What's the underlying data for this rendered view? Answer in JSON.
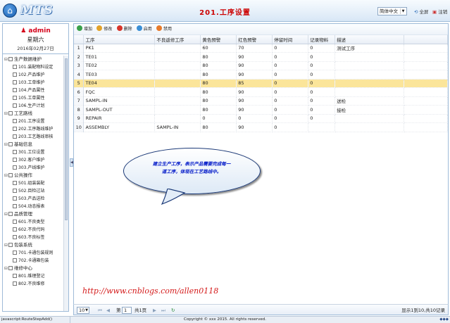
{
  "header": {
    "logo_glyph": "⌂",
    "logo_text": "MTS",
    "title": "201.工序设置",
    "language": "简体中文",
    "fullscreen": "全屏",
    "logout": "注销"
  },
  "user": {
    "name": "admin",
    "weekday": "星期六",
    "date": "2016年02月27日"
  },
  "tree": [
    {
      "label": "生产数据维护",
      "items": [
        "101.装配物料设定",
        "102.产品维护",
        "103.工单维护",
        "104.产品属性",
        "105.工单属性",
        "106.生产计划"
      ]
    },
    {
      "label": "工艺路线",
      "items": [
        "201.工序设置",
        "202.工序路线维护",
        "203.工艺路线审核"
      ]
    },
    {
      "label": "基础信息",
      "items": [
        "301.工位设置",
        "302.客户维护",
        "303.产线维护"
      ]
    },
    {
      "label": "公共操作",
      "items": [
        "501.组装装配",
        "502.目检过站",
        "503.产品送检",
        "504.动态报表"
      ]
    },
    {
      "label": "品质管理",
      "items": [
        "601.不良类型",
        "602.不良代码",
        "603.不良标签"
      ]
    },
    {
      "label": "包装系统",
      "items": [
        "701.卡通包装规则",
        "702.卡通箱包装"
      ]
    },
    {
      "label": "维修中心",
      "items": [
        "801.维理登记",
        "802.不良维修"
      ]
    }
  ],
  "toolbar": {
    "add": "增加",
    "edit": "修改",
    "delete": "删除",
    "enable": "启用",
    "disable": "禁用"
  },
  "table": {
    "columns": [
      "工序",
      "不良返修工序",
      "黄色预警",
      "红色预警",
      "停留时间",
      "记录物料",
      "描述"
    ],
    "rows": [
      {
        "n": "1",
        "c": [
          "PK1",
          "",
          "60",
          "70",
          "0",
          "0",
          "测试工序"
        ]
      },
      {
        "n": "2",
        "c": [
          "TE01",
          "",
          "80",
          "90",
          "0",
          "0",
          ""
        ]
      },
      {
        "n": "3",
        "c": [
          "TE02",
          "",
          "80",
          "90",
          "0",
          "0",
          ""
        ]
      },
      {
        "n": "4",
        "c": [
          "TE03",
          "",
          "80",
          "90",
          "0",
          "0",
          ""
        ]
      },
      {
        "n": "5",
        "c": [
          "TE04",
          "",
          "80",
          "85",
          "0",
          "0",
          ""
        ]
      },
      {
        "n": "6",
        "c": [
          "FQC",
          "",
          "80",
          "90",
          "0",
          "0",
          ""
        ]
      },
      {
        "n": "7",
        "c": [
          "SAMPL-IN",
          "",
          "80",
          "90",
          "0",
          "0",
          "送检"
        ]
      },
      {
        "n": "8",
        "c": [
          "SAMPL-OUT",
          "",
          "80",
          "90",
          "0",
          "0",
          "接检"
        ]
      },
      {
        "n": "9",
        "c": [
          "REPAIR",
          "",
          "0",
          "0",
          "0",
          "0",
          ""
        ]
      },
      {
        "n": "10",
        "c": [
          "ASSEMBLY",
          "SAMPL-IN",
          "80",
          "90",
          "0",
          "",
          ""
        ]
      }
    ]
  },
  "callout": {
    "line1": "建立生产工序，表示产品需要完成每一",
    "line2": "道工序，体现在工艺路线中。"
  },
  "watermark": "http://www.cnblogs.com/allen0118",
  "pager": {
    "page_size": "10",
    "page_label": "第",
    "page": "1",
    "total": "共1页",
    "summary": "显示1到10,共10记录"
  },
  "status": {
    "left": "javascript:RouteStepAdd()",
    "center": "Copyright © xxx 2015. All rights reserved.",
    "right": "◆◆◆"
  },
  "colors": {
    "accent_red": "#cc0000",
    "selected_row": "#fbe59a",
    "callout_text": "#0018c8"
  }
}
